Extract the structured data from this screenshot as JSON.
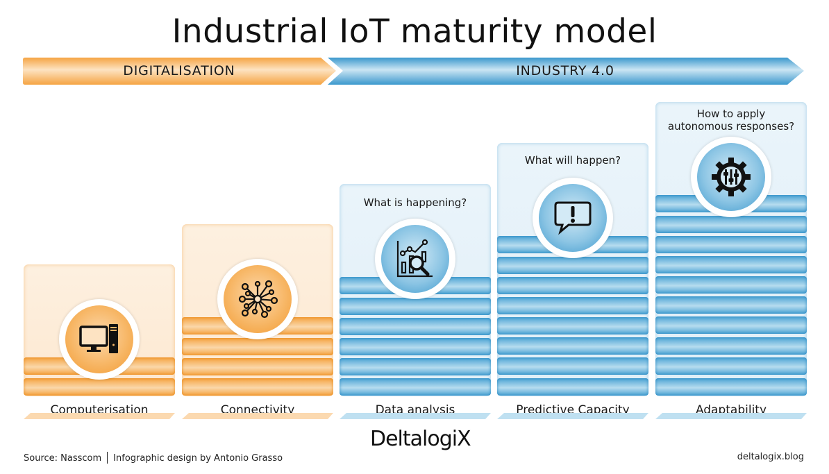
{
  "title": "Industrial IoT maturity model",
  "phases": [
    {
      "label": "DIGITALISATION",
      "color": "#f5a443"
    },
    {
      "label": "INDUSTRY 4.0",
      "color": "#3b98cd"
    }
  ],
  "stages": [
    {
      "label": "Computerisation",
      "question": "",
      "icon": "computer-icon",
      "phase": "DIGITALISATION",
      "level": 1,
      "bars": 2
    },
    {
      "label": "Connectivity",
      "question": "",
      "icon": "network-hub-icon",
      "phase": "DIGITALISATION",
      "level": 2,
      "bars": 4
    },
    {
      "label": "Data analysis",
      "question": "What is happening?",
      "icon": "chart-magnifier-icon",
      "phase": "INDUSTRY 4.0",
      "level": 3,
      "bars": 6
    },
    {
      "label": "Predictive Capacity",
      "question": "What will happen?",
      "icon": "alert-speech-bubble-icon",
      "phase": "INDUSTRY 4.0",
      "level": 4,
      "bars": 8
    },
    {
      "label": "Adaptability",
      "question_line1": "How to apply",
      "question_line2": "autonomous responses?",
      "icon": "gear-sliders-icon",
      "phase": "INDUSTRY 4.0",
      "level": 5,
      "bars": 10
    }
  ],
  "footer": {
    "source": "Source: Nasscom",
    "credit": "Infographic design by Antonio Grasso",
    "logo": "DeltalogiX",
    "website": "deltalogix.blog"
  }
}
